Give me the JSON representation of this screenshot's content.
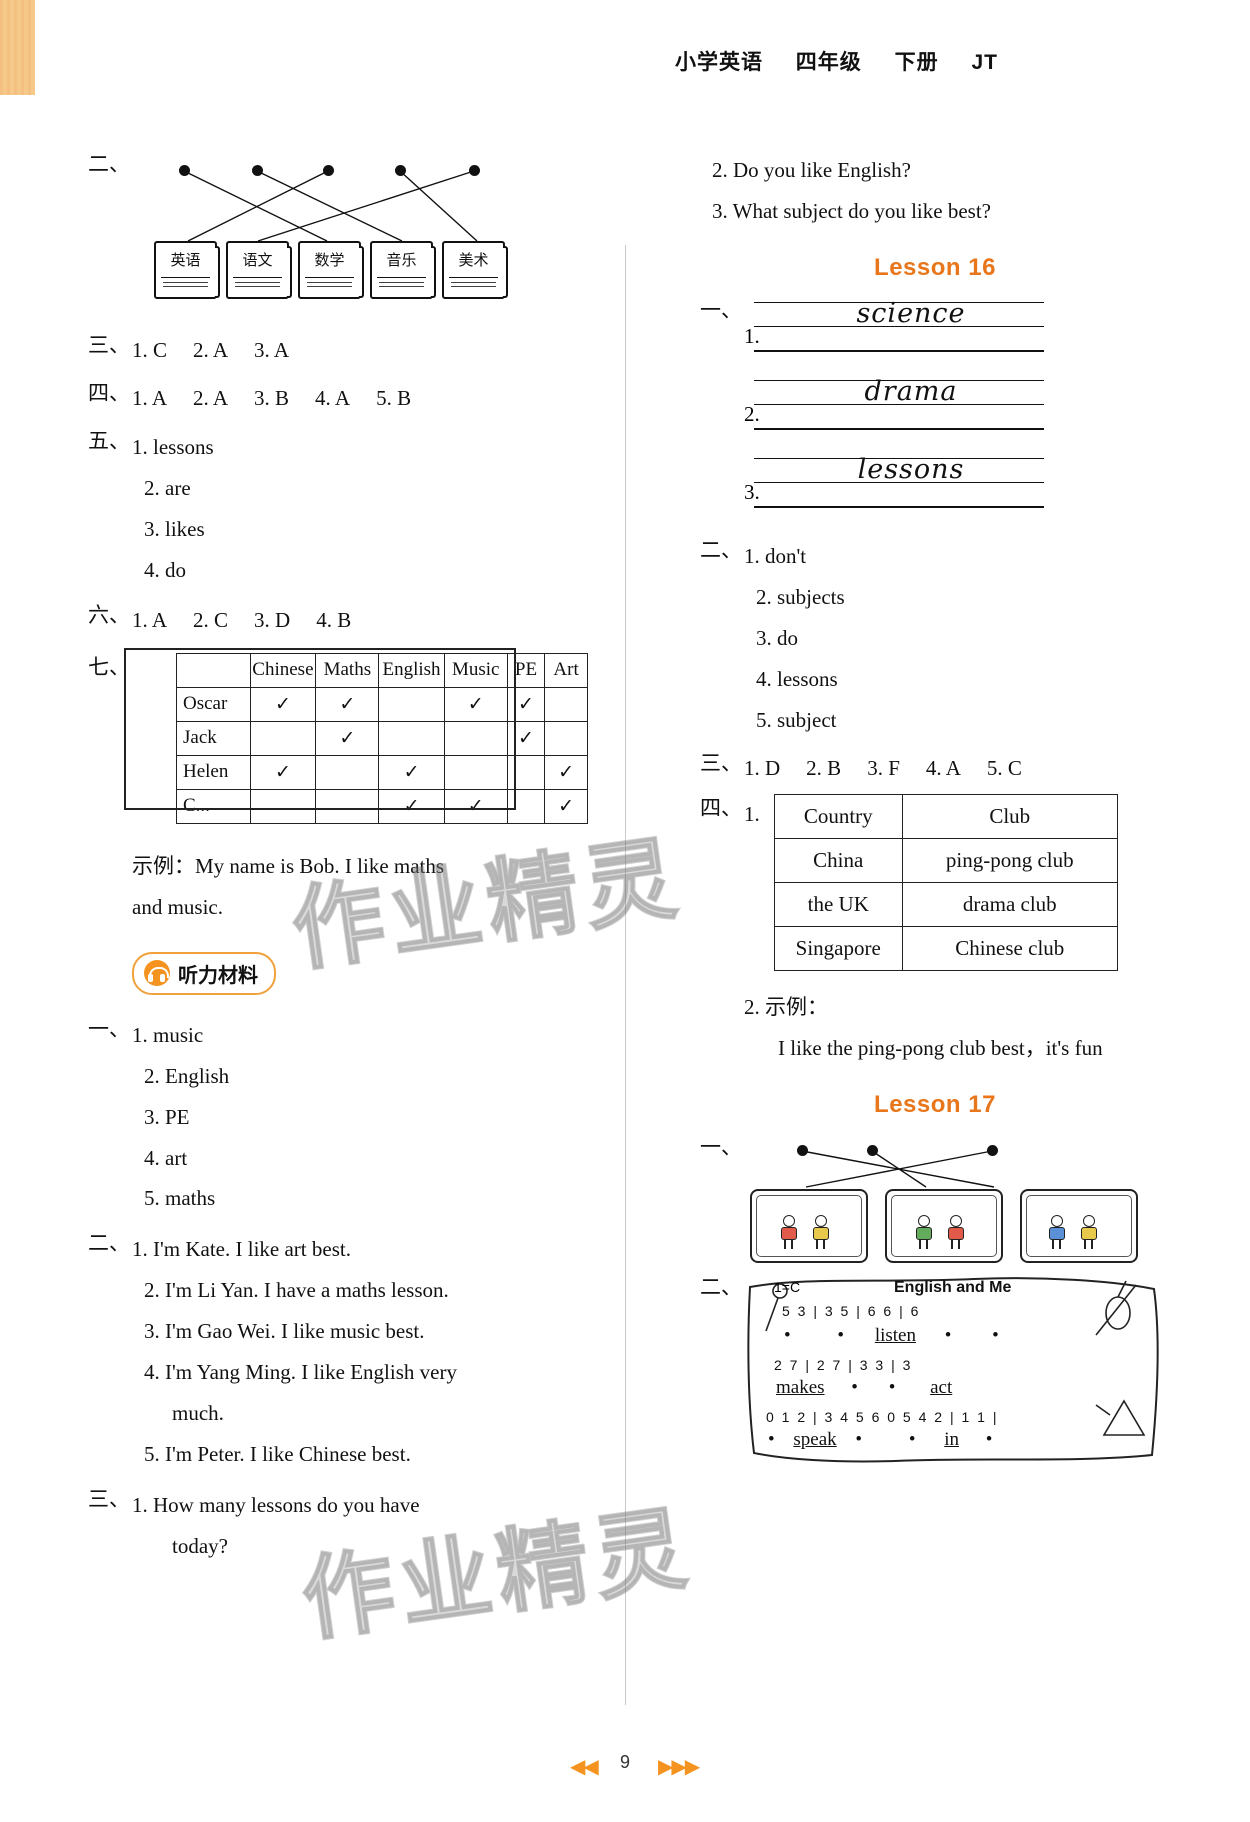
{
  "header": {
    "subject": "小学英语",
    "grade": "四年级",
    "volume": "下册",
    "edition": "JT"
  },
  "footer": {
    "page": "9",
    "nav_prev": "◀◀",
    "nav_next": "▶▶▶"
  },
  "watermark": "作业精灵",
  "left_column": {
    "ex2": {
      "marker": "二、",
      "books": [
        "英语",
        "语文",
        "数学",
        "音乐",
        "美术"
      ]
    },
    "ex3": {
      "marker": "三、",
      "items": [
        "1. C",
        "2. A",
        "3. A"
      ]
    },
    "ex4": {
      "marker": "四、",
      "items": [
        "1. A",
        "2. A",
        "3. B",
        "4. A",
        "5. B"
      ]
    },
    "ex5": {
      "marker": "五、",
      "items": [
        "1. lessons",
        "2. are",
        "3. likes",
        "4. do"
      ]
    },
    "ex6": {
      "marker": "六、",
      "items": [
        "1. A",
        "2. C",
        "3. D",
        "4. B"
      ]
    },
    "ex7": {
      "marker": "七、",
      "table": {
        "columns": [
          "",
          "Chinese",
          "Maths",
          "English",
          "Music",
          "PE",
          "Art"
        ],
        "rows": [
          {
            "name": "Oscar",
            "marks": [
              "✓",
              "✓",
              "",
              "✓",
              "✓",
              ""
            ]
          },
          {
            "name": "Jack",
            "marks": [
              "",
              "✓",
              "",
              "",
              "✓",
              ""
            ]
          },
          {
            "name": "Helen",
            "marks": [
              "✓",
              "",
              "✓",
              "",
              "",
              "✓"
            ]
          },
          {
            "name": "C...",
            "marks": [
              "",
              "",
              "✓",
              "✓",
              "",
              "✓"
            ]
          }
        ]
      },
      "example_label": "示例：",
      "example_text_1": "My name is Bob. I like maths",
      "example_text_2": "and music."
    },
    "listening": {
      "badge": "听力材料",
      "icon": "headphones-icon",
      "ex1": {
        "marker": "一、",
        "items": [
          "1. music",
          "2. English",
          "3. PE",
          "4. art",
          "5. maths"
        ]
      },
      "ex2": {
        "marker": "二、",
        "items": [
          "1. I'm Kate. I like art best.",
          "2. I'm Li Yan. I have a maths lesson.",
          "3. I'm Gao Wei. I like music best.",
          "4. I'm Yang Ming. I like English very",
          "much.",
          "5. I'm Peter. I like Chinese best."
        ]
      },
      "ex3": {
        "marker": "三、",
        "items": [
          "1. How  many  lessons  do  you  have",
          "today?"
        ]
      }
    }
  },
  "right_column": {
    "listening_cont": [
      "2. Do you like English?",
      "3. What subject do you like best?"
    ],
    "lesson16": {
      "title": "Lesson 16",
      "ex1": {
        "marker": "一、",
        "items": [
          {
            "num": "1.",
            "word": "science"
          },
          {
            "num": "2.",
            "word": "drama"
          },
          {
            "num": "3.",
            "word": "lessons"
          }
        ]
      },
      "ex2": {
        "marker": "二、",
        "items": [
          "1. don't",
          "2. subjects",
          "3. do",
          "4. lessons",
          "5. subject"
        ]
      },
      "ex3": {
        "marker": "三、",
        "items": [
          "1. D",
          "2. B",
          "3. F",
          "4. A",
          "5. C"
        ]
      },
      "ex4": {
        "marker": "四、",
        "num1": "1.",
        "table": {
          "columns": [
            "Country",
            "Club"
          ],
          "rows": [
            [
              "China",
              "ping-pong club"
            ],
            [
              "the UK",
              "drama club"
            ],
            [
              "Singapore",
              "Chinese club"
            ]
          ]
        },
        "num2": "2.",
        "example_label": "示例：",
        "example_text": "I like the ping-pong club best，it's fun"
      }
    },
    "lesson17": {
      "title": "Lesson 17",
      "ex1": {
        "marker": "一、"
      },
      "ex2": {
        "marker": "二、",
        "song_title": "English and Me",
        "key": "1=C",
        "staff_rows": [
          {
            "notes": "5    3 | 3      5 | 6      6 | 6",
            "lyrics": [
              "•",
              "•",
              "listen",
              "•",
              "•"
            ]
          },
          {
            "notes": "2    7 | 2      7 | 3      3 | 3",
            "lyrics": [
              "makes",
              "•",
              "•",
              "act"
            ]
          },
          {
            "notes": "0  1 2 | 3   4  5 6    0 5    4 2 | 1    1 |",
            "lyrics": [
              "•",
              "speak",
              "•",
              "•",
              "in",
              "•"
            ]
          }
        ]
      }
    }
  }
}
